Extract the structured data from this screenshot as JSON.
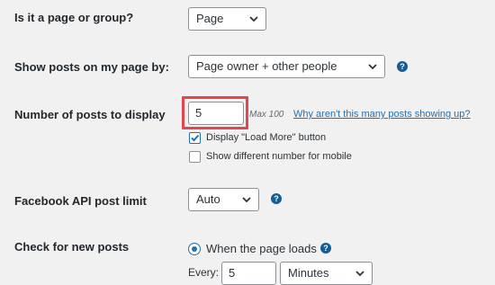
{
  "rows": {
    "type": {
      "label": "Is it a page or group?",
      "selected": "Page"
    },
    "show_posts": {
      "label": "Show posts on my page by:",
      "selected": "Page owner + other people"
    },
    "num_posts": {
      "label": "Number of posts to display",
      "value": "5",
      "max_hint": "Max 100",
      "help_link": "Why aren't this many posts showing up?",
      "load_more_label": "Display \"Load More\" button",
      "load_more_checked": true,
      "mobile_label": "Show different number for mobile",
      "mobile_checked": false
    },
    "api_limit": {
      "label": "Facebook API post limit",
      "selected": "Auto"
    },
    "check_new": {
      "label": "Check for new posts",
      "radio_label": "When the page loads",
      "every_label": "Every:",
      "every_value": "5",
      "unit_selected": "Minutes"
    }
  },
  "icons": {
    "help": "?"
  },
  "colors": {
    "accent": "#2271b1",
    "highlight": "#e0474f",
    "help": "#135e96"
  }
}
